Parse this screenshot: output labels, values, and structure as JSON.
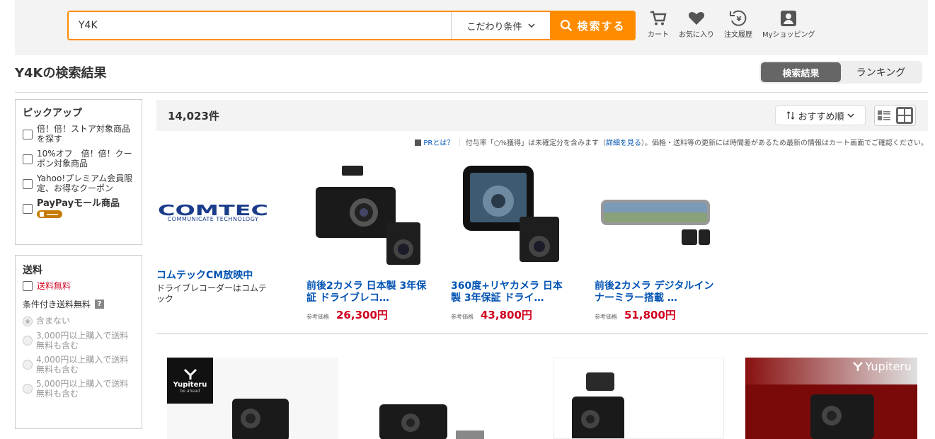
{
  "search": {
    "value": "Y4K",
    "condition_label": "こだわり条件",
    "button_label": "検索する"
  },
  "header_icons": [
    {
      "label": "カート",
      "icon": "cart-icon"
    },
    {
      "label": "お気に入り",
      "icon": "heart-icon"
    },
    {
      "label": "注文履歴",
      "icon": "history-icon"
    },
    {
      "label": "Myショッピング",
      "icon": "person-icon"
    }
  ],
  "page_title": "Y4Kの検索結果",
  "tabs": [
    {
      "label": "検索結果",
      "active": true
    },
    {
      "label": "ランキング",
      "active": false
    }
  ],
  "pickup": {
    "title": "ピックアップ",
    "items": [
      "倍！倍！ストア対象商品を探す",
      "10%オフ　倍！倍！クーポン対象商品",
      "Yahoo!プレミアム会員限定、お得なクーポン",
      "PayPayモール商品"
    ],
    "badge_logo": "PayPayモール"
  },
  "shipping": {
    "title": "送料",
    "free_label": "送料無料",
    "conditional_label": "条件付き送料無料",
    "help_icon": "?",
    "options": [
      "含まない",
      "3,000円以上購入で送料無料も含む",
      "4,000円以上購入で送料無料も含む",
      "5,000円以上購入で送料無料も含む"
    ]
  },
  "results": {
    "count": "14,023件",
    "sort_label": "おすすめ順"
  },
  "notice": {
    "pr": "PRとは？",
    "sep": "｜",
    "text1": "付与率「○%獲得」は未確定分を含みます（",
    "link": "詳細を見る",
    "text2": "）。価格・送料等の更新には時間差があるため最新の情報はカート画面でご確認ください。"
  },
  "pr_ads": [
    {
      "brand_logo": "COMTEC",
      "brand_sub": "COMMUNICATE TECHNOLOGY",
      "title": "コムテックCM放映中",
      "desc": "ドライブレコーダーはコムテック"
    },
    {
      "name": "前後2カメラ 日本製 3年保証 ドライブレコ…",
      "price_label": "参考価格",
      "price": "26,300円"
    },
    {
      "name": "360度+リヤカメラ 日本製 3年保証 ドライ…",
      "price_label": "参考価格",
      "price": "43,800円"
    },
    {
      "name": "前後2カメラ デジタルインナーミラー搭載 …",
      "price_label": "参考価格",
      "price": "51,800円"
    }
  ],
  "listing_logos": {
    "yupiteru": "Yupiteru",
    "yupiteru_sub": "be ahead"
  },
  "colors": {
    "accent": "#ff8c00",
    "link": "#0052b3",
    "price": "#d0001f"
  }
}
